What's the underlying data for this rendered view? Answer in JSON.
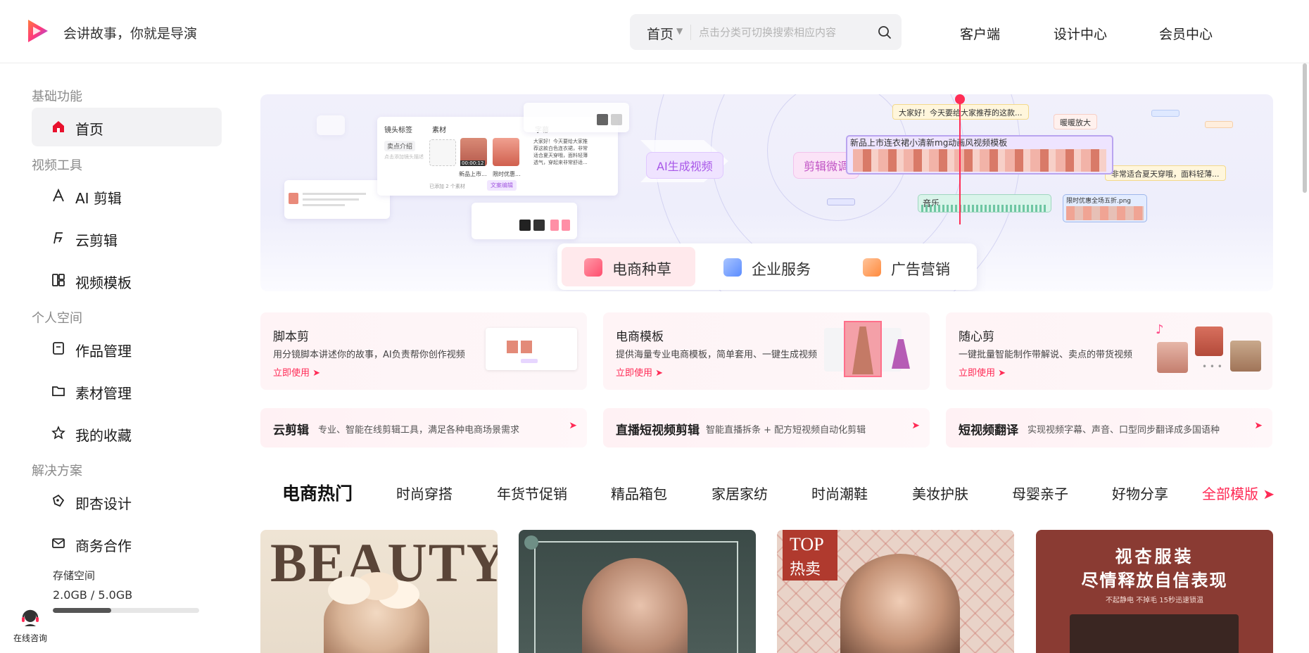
{
  "header": {
    "slogan": "会讲故事，你就是导演",
    "search": {
      "category": "首页",
      "placeholder": "点击分类可切换搜索相应内容"
    },
    "nav": [
      "客户端",
      "设计中心",
      "会员中心"
    ]
  },
  "sidebar": {
    "sections": [
      {
        "title": "基础功能",
        "items": [
          {
            "label": "首页",
            "icon": "home-icon",
            "active": true
          }
        ]
      },
      {
        "title": "视频工具",
        "items": [
          {
            "label": "AI 剪辑",
            "icon": "ai-edit-icon"
          },
          {
            "label": "云剪辑",
            "icon": "cloud-edit-icon"
          },
          {
            "label": "视频模板",
            "icon": "template-icon"
          }
        ]
      },
      {
        "title": "个人空间",
        "items": [
          {
            "label": "作品管理",
            "icon": "works-icon"
          },
          {
            "label": "素材管理",
            "icon": "folder-icon"
          },
          {
            "label": "我的收藏",
            "icon": "star-icon"
          }
        ]
      },
      {
        "title": "解决方案",
        "items": [
          {
            "label": "即杏设计",
            "icon": "design-icon"
          },
          {
            "label": "商务合作",
            "icon": "mail-icon"
          }
        ]
      }
    ],
    "storage": {
      "label": "存储空间",
      "value": "2.0GB / 5.0GB",
      "used_fraction": 0.4
    },
    "consult": "在线咨询"
  },
  "banner": {
    "ai_pill": "AI生成视频",
    "edit_pill": "剪辑微调",
    "timeline_title": "新品上市连衣裙小清新mg动画风视频模板",
    "chips": [
      "大家好！今天要给大家推荐的这款...",
      "暖暖放大",
      "非常适合夏天穿哦，面料轻薄..."
    ],
    "music_label": "音乐",
    "clip_label": "限时优惠全场五折.png",
    "editor": {
      "headers": [
        "镜头标签",
        "素材",
        "字幕"
      ],
      "dropdown": "卖点介绍",
      "hint": "点击添加镜头描述",
      "added": "已添加 2 个素材",
      "clip_names": [
        "新品上市...",
        "限时优惠..."
      ],
      "duration": "00:00:12",
      "caption": "大家好！今天要给大家推荐这款白色连衣裙，非常适合夏天穿哦，面料轻薄透气，穿起来非常舒适...",
      "ai_button": "文案编辑"
    },
    "tabs": [
      {
        "label": "电商种草",
        "active": true,
        "color": "#ff4d6d"
      },
      {
        "label": "企业服务",
        "color": "#5b8cff"
      },
      {
        "label": "广告营销",
        "color": "#ff9a4d"
      }
    ]
  },
  "features": [
    {
      "title": "脚本剪",
      "desc": "用分镜脚本讲述你的故事，AI负责帮你创作视频",
      "link": "立即使用"
    },
    {
      "title": "电商模板",
      "desc": "提供海量专业电商模板，简单套用、一键生成视频",
      "link": "立即使用"
    },
    {
      "title": "随心剪",
      "desc": "一键批量智能制作带解说、卖点的带货视频",
      "link": "立即使用"
    }
  ],
  "tools": [
    {
      "title": "云剪辑",
      "desc": "专业、智能在线剪辑工具，满足各种电商场景需求"
    },
    {
      "title": "直播短视频剪辑",
      "desc": "智能直播拆条 + 配方短视频自动化剪辑"
    },
    {
      "title": "短视频翻译",
      "desc": "实现视频字幕、声音、口型同步翻译成多国语种"
    }
  ],
  "categories": {
    "active": "电商热门",
    "items": [
      "时尚穿搭",
      "年货节促销",
      "精品箱包",
      "家居家纺",
      "时尚潮鞋",
      "美妆护肤",
      "母婴亲子",
      "好物分享"
    ],
    "all": "全部模版 ➤"
  },
  "templates": [
    {
      "text": "BEAUTY"
    },
    {
      "text": ""
    },
    {
      "text": "TOP",
      "sub": "热卖"
    },
    {
      "text": "视杏服装",
      "sub": "尽情释放自信表现",
      "small": "不起静电 不掉毛 15秒迅速锁温"
    }
  ]
}
